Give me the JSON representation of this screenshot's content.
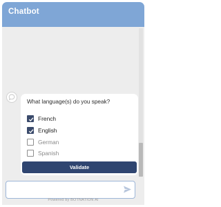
{
  "header": {
    "title": "Chatbot"
  },
  "message": {
    "question": "What language(s) do you speak?",
    "options": [
      {
        "label": "French",
        "checked": true
      },
      {
        "label": "English",
        "checked": true
      },
      {
        "label": "German",
        "checked": false
      },
      {
        "label": "Spanish",
        "checked": false
      }
    ],
    "validate_label": "Validate"
  },
  "input": {
    "placeholder": "",
    "powered_by": "Powered by BOTNATION AI"
  },
  "colors": {
    "header": "#7fa6d6",
    "button": "#2f4570",
    "checkbox": "#3a4a6b"
  },
  "icons": {
    "avatar": "chat-bubble-icon",
    "send": "send-icon"
  }
}
